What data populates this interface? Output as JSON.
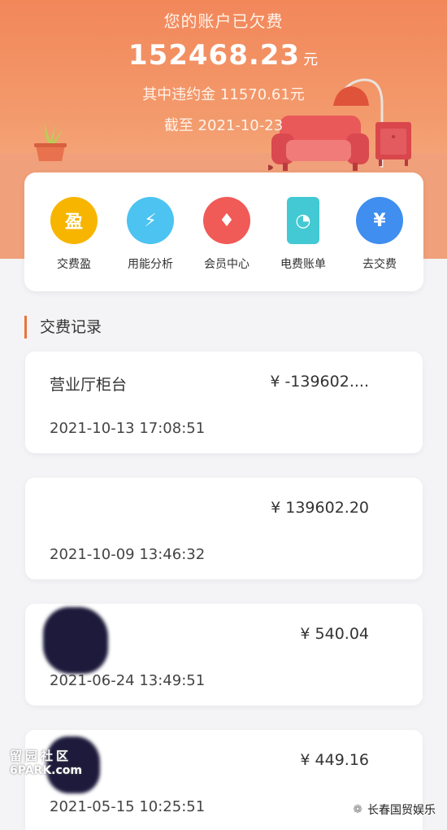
{
  "header": {
    "title": "您的账户已欠费",
    "amount": "152468.23",
    "amount_unit": "元",
    "penalty_text": "其中违约金 11570.61元",
    "until_text": "截至 2021-10-23"
  },
  "menu": [
    {
      "label": "交费盈",
      "icon": "ying-icon",
      "glyph": "盈",
      "color": "#f7b500"
    },
    {
      "label": "用能分析",
      "icon": "energy-analysis-icon",
      "glyph": "⚡",
      "color": "#4cc3f0"
    },
    {
      "label": "会员中心",
      "icon": "diamond-icon",
      "glyph": "♦",
      "color": "#f05a57"
    },
    {
      "label": "电费账单",
      "icon": "bill-icon",
      "glyph": "◔",
      "color": "#42c9d3"
    },
    {
      "label": "去交费",
      "icon": "yen-bulb-icon",
      "glyph": "¥",
      "color": "#3f8ef0"
    }
  ],
  "section": {
    "title": "交费记录"
  },
  "records": [
    {
      "name": "营业厅柜台",
      "amount": "¥ -139602....",
      "time": "2021-10-13 17:08:51"
    },
    {
      "name": "",
      "amount": "¥ 139602.20",
      "time": "2021-10-09 13:46:32"
    },
    {
      "name": "",
      "amount": "¥ 540.04",
      "time": "2021-06-24 13:49:51"
    },
    {
      "name": "",
      "amount": "¥ 449.16",
      "time": "2021-05-15 10:25:51"
    }
  ],
  "watermarks": {
    "left_top": "留园社区",
    "left_bottom": "6PARK.com",
    "right": "长春国贸娱乐"
  }
}
